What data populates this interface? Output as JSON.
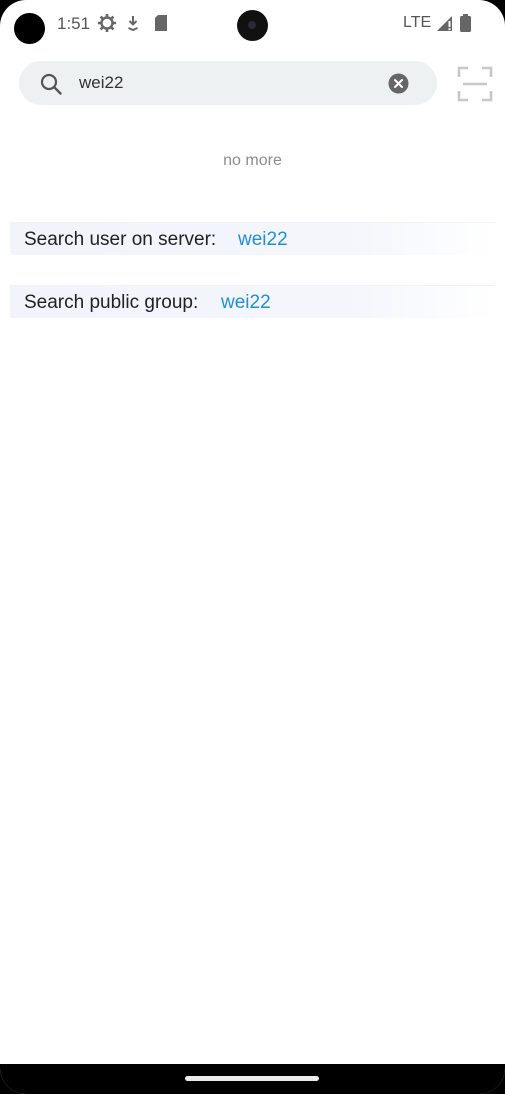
{
  "status_bar": {
    "time": "1:51",
    "network": "LTE",
    "icons": [
      "settings-icon",
      "download-icon",
      "sd-card-icon",
      "signal-icon",
      "battery-icon"
    ]
  },
  "search": {
    "value": "wei22",
    "placeholder": ""
  },
  "list": {
    "no_more_text": "no more"
  },
  "results": [
    {
      "label": "Search user on server:",
      "term": "wei22"
    },
    {
      "label": "Search public group:",
      "term": "wei22"
    }
  ],
  "colors": {
    "accent": "#1e90d6",
    "search_bg": "#eef1f2",
    "row_bg": "#f2f4fb"
  }
}
